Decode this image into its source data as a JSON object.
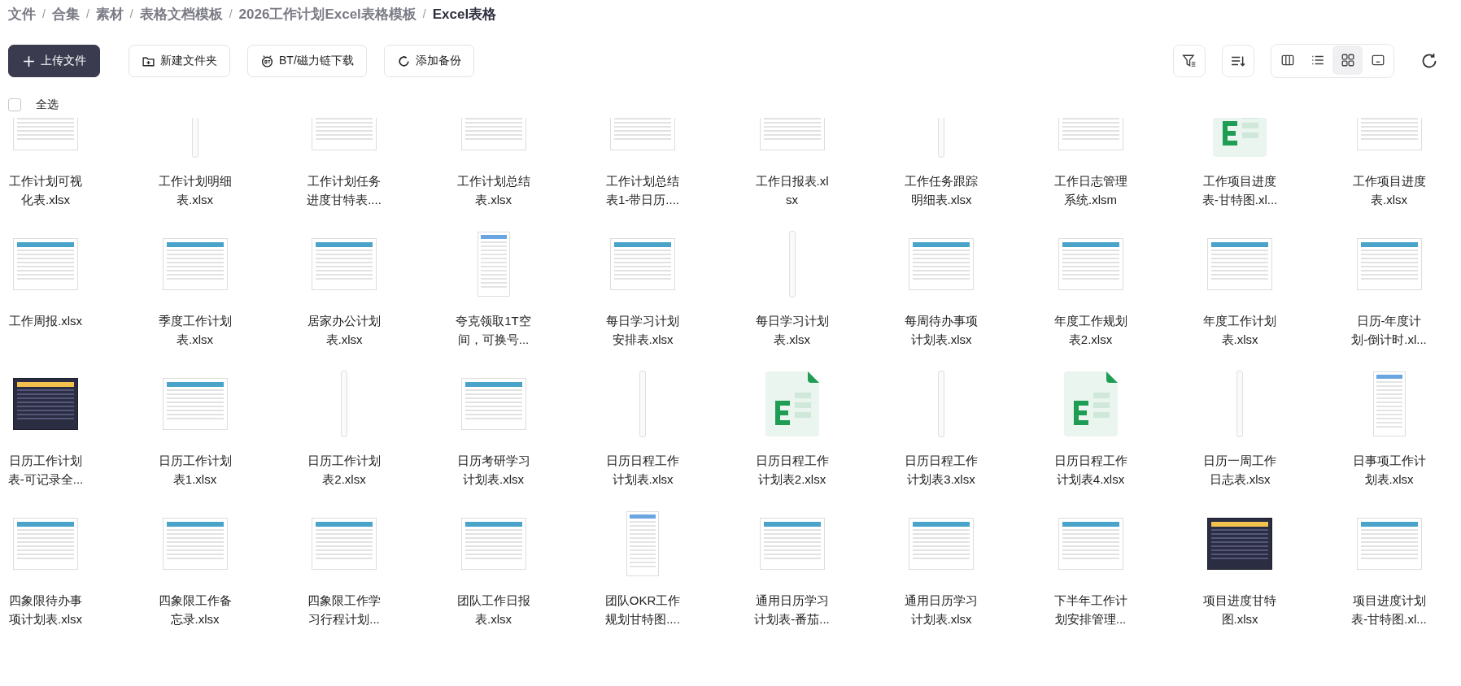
{
  "breadcrumb": [
    {
      "label": "文件",
      "current": false
    },
    {
      "label": "合集",
      "current": false
    },
    {
      "label": "素材",
      "current": false
    },
    {
      "label": "表格文档模板",
      "current": false
    },
    {
      "label": "2026工作计划Excel表格模板",
      "current": false
    },
    {
      "label": "Excel表格",
      "current": true
    }
  ],
  "breadcrumb_separator": "/",
  "actions": [
    {
      "label": "上传文件",
      "kind": "primary"
    },
    {
      "label": "新建文件夹",
      "kind": "default"
    },
    {
      "label": "BT/磁力链下载",
      "kind": "default"
    },
    {
      "label": "添加备份",
      "kind": "default"
    }
  ],
  "view_modes": [
    {
      "selected": false
    },
    {
      "selected": false
    },
    {
      "selected": true
    },
    {
      "selected": false
    }
  ],
  "select_all": {
    "label": "全选",
    "checked": false
  },
  "files": [
    {
      "name": "工作计划可视化表.xlsx",
      "kind": "sheet"
    },
    {
      "name": "工作计划明细表.xlsx",
      "kind": "strip"
    },
    {
      "name": "工作计划任务进度甘特表....",
      "kind": "sheet"
    },
    {
      "name": "工作计划总结表.xlsx",
      "kind": "sheet"
    },
    {
      "name": "工作计划总结表1-带日历....",
      "kind": "sheet"
    },
    {
      "name": "工作日报表.xlsx",
      "kind": "sheet"
    },
    {
      "name": "工作任务跟踪明细表.xlsx",
      "kind": "strip"
    },
    {
      "name": "工作日志管理系统.xlsm",
      "kind": "sheet"
    },
    {
      "name": "工作项目进度表-甘特图.xl...",
      "kind": "excel"
    },
    {
      "name": "工作项目进度表.xlsx",
      "kind": "sheet"
    },
    {
      "name": "工作周报.xlsx",
      "kind": "sheet"
    },
    {
      "name": "季度工作计划表.xlsx",
      "kind": "sheet"
    },
    {
      "name": "居家办公计划表.xlsx",
      "kind": "sheet"
    },
    {
      "name": "夸克领取1T空间，可换号...",
      "kind": "portrait"
    },
    {
      "name": "每日学习计划安排表.xlsx",
      "kind": "sheet"
    },
    {
      "name": "每日学习计划表.xlsx",
      "kind": "strip"
    },
    {
      "name": "每周待办事项计划表.xlsx",
      "kind": "sheet"
    },
    {
      "name": "年度工作规划表2.xlsx",
      "kind": "sheet"
    },
    {
      "name": "年度工作计划表.xlsx",
      "kind": "sheet"
    },
    {
      "name": "日历-年度计划-倒计时.xl...",
      "kind": "sheet"
    },
    {
      "name": "日历工作计划表-可记录全...",
      "kind": "dark"
    },
    {
      "name": "日历工作计划表1.xlsx",
      "kind": "sheet"
    },
    {
      "name": "日历工作计划表2.xlsx",
      "kind": "strip"
    },
    {
      "name": "日历考研学习计划表.xlsx",
      "kind": "sheet"
    },
    {
      "name": "日历日程工作计划表.xlsx",
      "kind": "strip"
    },
    {
      "name": "日历日程工作计划表2.xlsx",
      "kind": "excel"
    },
    {
      "name": "日历日程工作计划表3.xlsx",
      "kind": "strip"
    },
    {
      "name": "日历日程工作计划表4.xlsx",
      "kind": "excel"
    },
    {
      "name": "日历一周工作日志表.xlsx",
      "kind": "strip"
    },
    {
      "name": "日事项工作计划表.xlsx",
      "kind": "portrait"
    },
    {
      "name": "四象限待办事项计划表.xlsx",
      "kind": "sheet"
    },
    {
      "name": "四象限工作备忘录.xlsx",
      "kind": "sheet"
    },
    {
      "name": "四象限工作学习行程计划...",
      "kind": "sheet"
    },
    {
      "name": "团队工作日报表.xlsx",
      "kind": "sheet"
    },
    {
      "name": "团队OKR工作规划甘特图....",
      "kind": "portrait"
    },
    {
      "name": "通用日历学习计划表-番茄...",
      "kind": "sheet"
    },
    {
      "name": "通用日历学习计划表.xlsx",
      "kind": "sheet"
    },
    {
      "name": "下半年工作计划安排管理...",
      "kind": "sheet"
    },
    {
      "name": "项目进度甘特图.xlsx",
      "kind": "dark"
    },
    {
      "name": "项目进度计划表-甘特图.xl...",
      "kind": "sheet"
    }
  ]
}
